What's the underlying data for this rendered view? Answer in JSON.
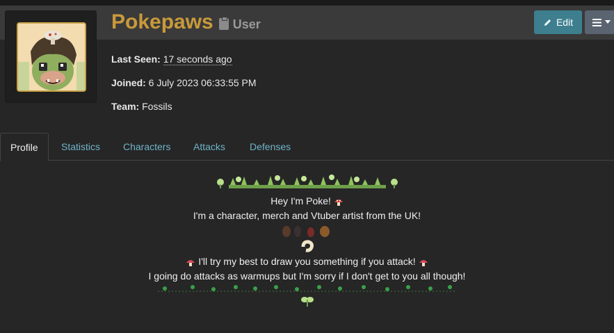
{
  "profile": {
    "name": "Pokepaws",
    "role": "User",
    "last_seen_label": "Last Seen:",
    "last_seen_value": "17 seconds ago",
    "joined_label": "Joined:",
    "joined_value": "6 July 2023 06:33:55 PM",
    "team_label": "Team:",
    "team_value": "Fossils"
  },
  "actions": {
    "edit_label": "Edit"
  },
  "tabs": [
    {
      "label": "Profile",
      "active": true
    },
    {
      "label": "Statistics",
      "active": false
    },
    {
      "label": "Characters",
      "active": false
    },
    {
      "label": "Attacks",
      "active": false
    },
    {
      "label": "Defenses",
      "active": false
    }
  ],
  "bio": {
    "line1": "Hey I'm Poke!",
    "line2": "I'm a character, merch and Vtuber artist from the UK!",
    "line3": "I'll try my best to draw you something if you attack!",
    "line4": "I going do attacks as warmups but I'm sorry if I don't get to you all though!"
  },
  "colors": {
    "name": "#c99a3a",
    "link": "#6fb3c9",
    "edit_button": "#3d7f8f"
  },
  "icons": {
    "role": "clipboard-icon",
    "edit": "pencil-icon",
    "menu": "hamburger-icon"
  }
}
